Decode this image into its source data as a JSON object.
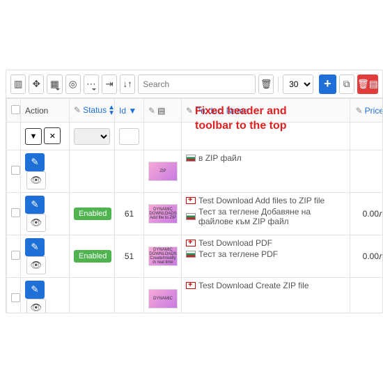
{
  "toolbar": {
    "search_placeholder": "Search",
    "page_size": "30"
  },
  "headers": {
    "action": "Action",
    "status": "Status",
    "id": "Id",
    "product_name": "Product Name",
    "price": "Price"
  },
  "rows": [
    {
      "id": "",
      "status_hidden": true,
      "thumb_text": "ZIP",
      "name_en": "",
      "name_bg": "в ZIP файл",
      "price": ""
    },
    {
      "id": "61",
      "status": "Enabled",
      "thumb_text": "DYNAMIC DOWNLOADS Add file to ZIP",
      "name_en": "Test Download Add files to ZIP file",
      "name_bg": "Тест за теглене Добавяне на файлове към ZIP файл",
      "price": "0.00л"
    },
    {
      "id": "51",
      "status": "Enabled",
      "thumb_text": "DYNAMIC DOWNLOADS Create/modify in real time",
      "name_en": "Test Download PDF",
      "name_bg": "Тест за теглене PDF",
      "price": "0.00л"
    },
    {
      "id": "",
      "status_hidden": true,
      "thumb_text": "DYNAMIC",
      "name_en": "Test Download Create ZIP file",
      "name_bg": "",
      "price": ""
    }
  ],
  "annotation": {
    "line1": "Fixed header and",
    "line2": "toolbar to the top"
  }
}
